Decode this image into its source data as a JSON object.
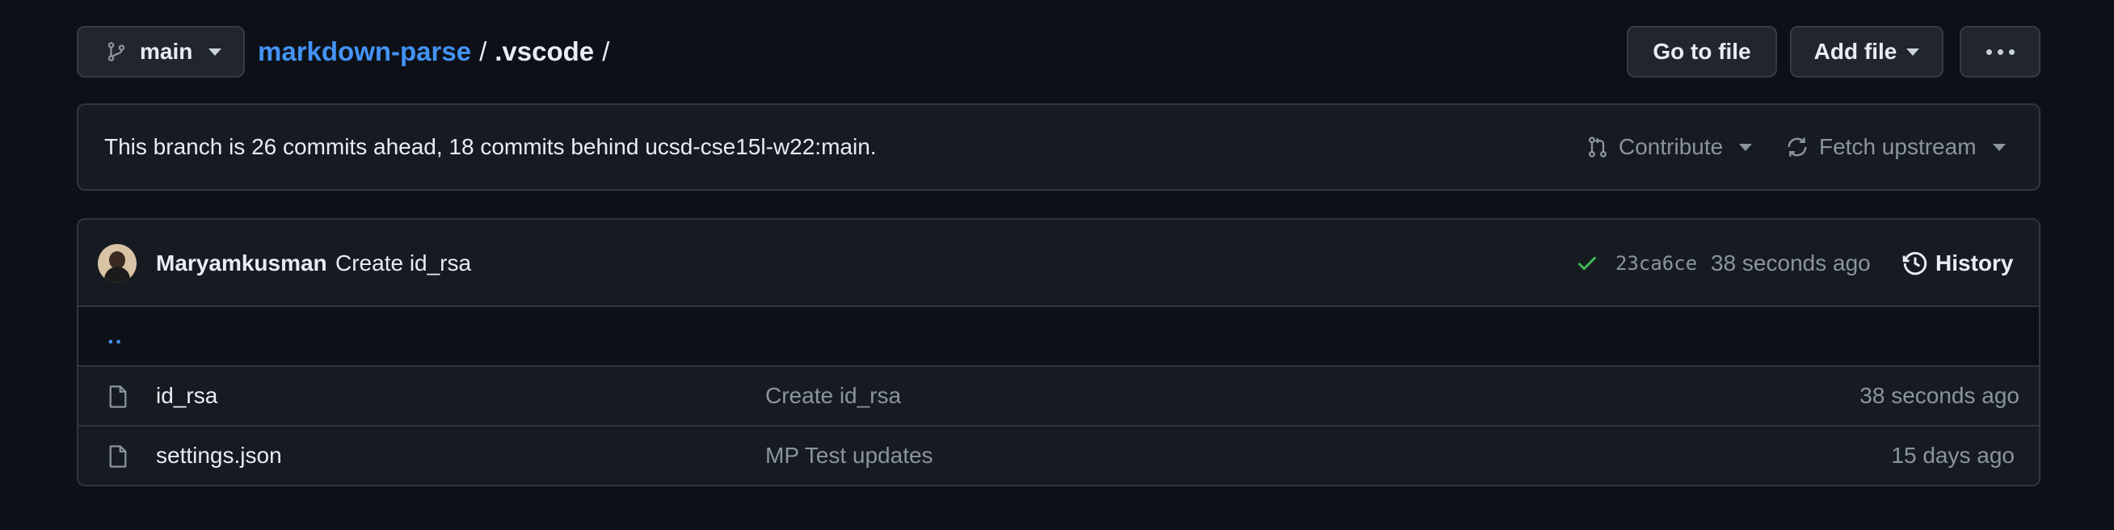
{
  "branch": {
    "name": "main",
    "icon": "git-branch-icon"
  },
  "breadcrumb": {
    "repo": "markdown-parse",
    "separator": "/",
    "dir": ".vscode",
    "trailing": "/"
  },
  "toolbar": {
    "go_to_file": "Go to file",
    "add_file": "Add file",
    "more_icon": "kebab-horizontal-icon"
  },
  "branch_status": {
    "message": "This branch is 26 commits ahead, 18 commits behind ucsd-cse15l-w22:main.",
    "contribute": "Contribute",
    "fetch_upstream": "Fetch upstream"
  },
  "latest_commit": {
    "author": "Maryamkusman",
    "message": "Create id_rsa",
    "status": "success",
    "sha": "23ca6ce",
    "time": "38 seconds ago",
    "history": "History"
  },
  "files": {
    "parent": "..",
    "rows": [
      {
        "name": "id_rsa",
        "message": "Create id_rsa",
        "age": "38 seconds ago",
        "icon": "file-icon"
      },
      {
        "name": "settings.json",
        "message": "MP Test updates",
        "age": "15 days ago",
        "icon": "file-icon"
      }
    ]
  },
  "colors": {
    "background": "#0d1117",
    "surface": "#161b22",
    "border": "#30363d",
    "link": "#4493f8",
    "muted": "#8b949e",
    "success": "#3fb950"
  }
}
